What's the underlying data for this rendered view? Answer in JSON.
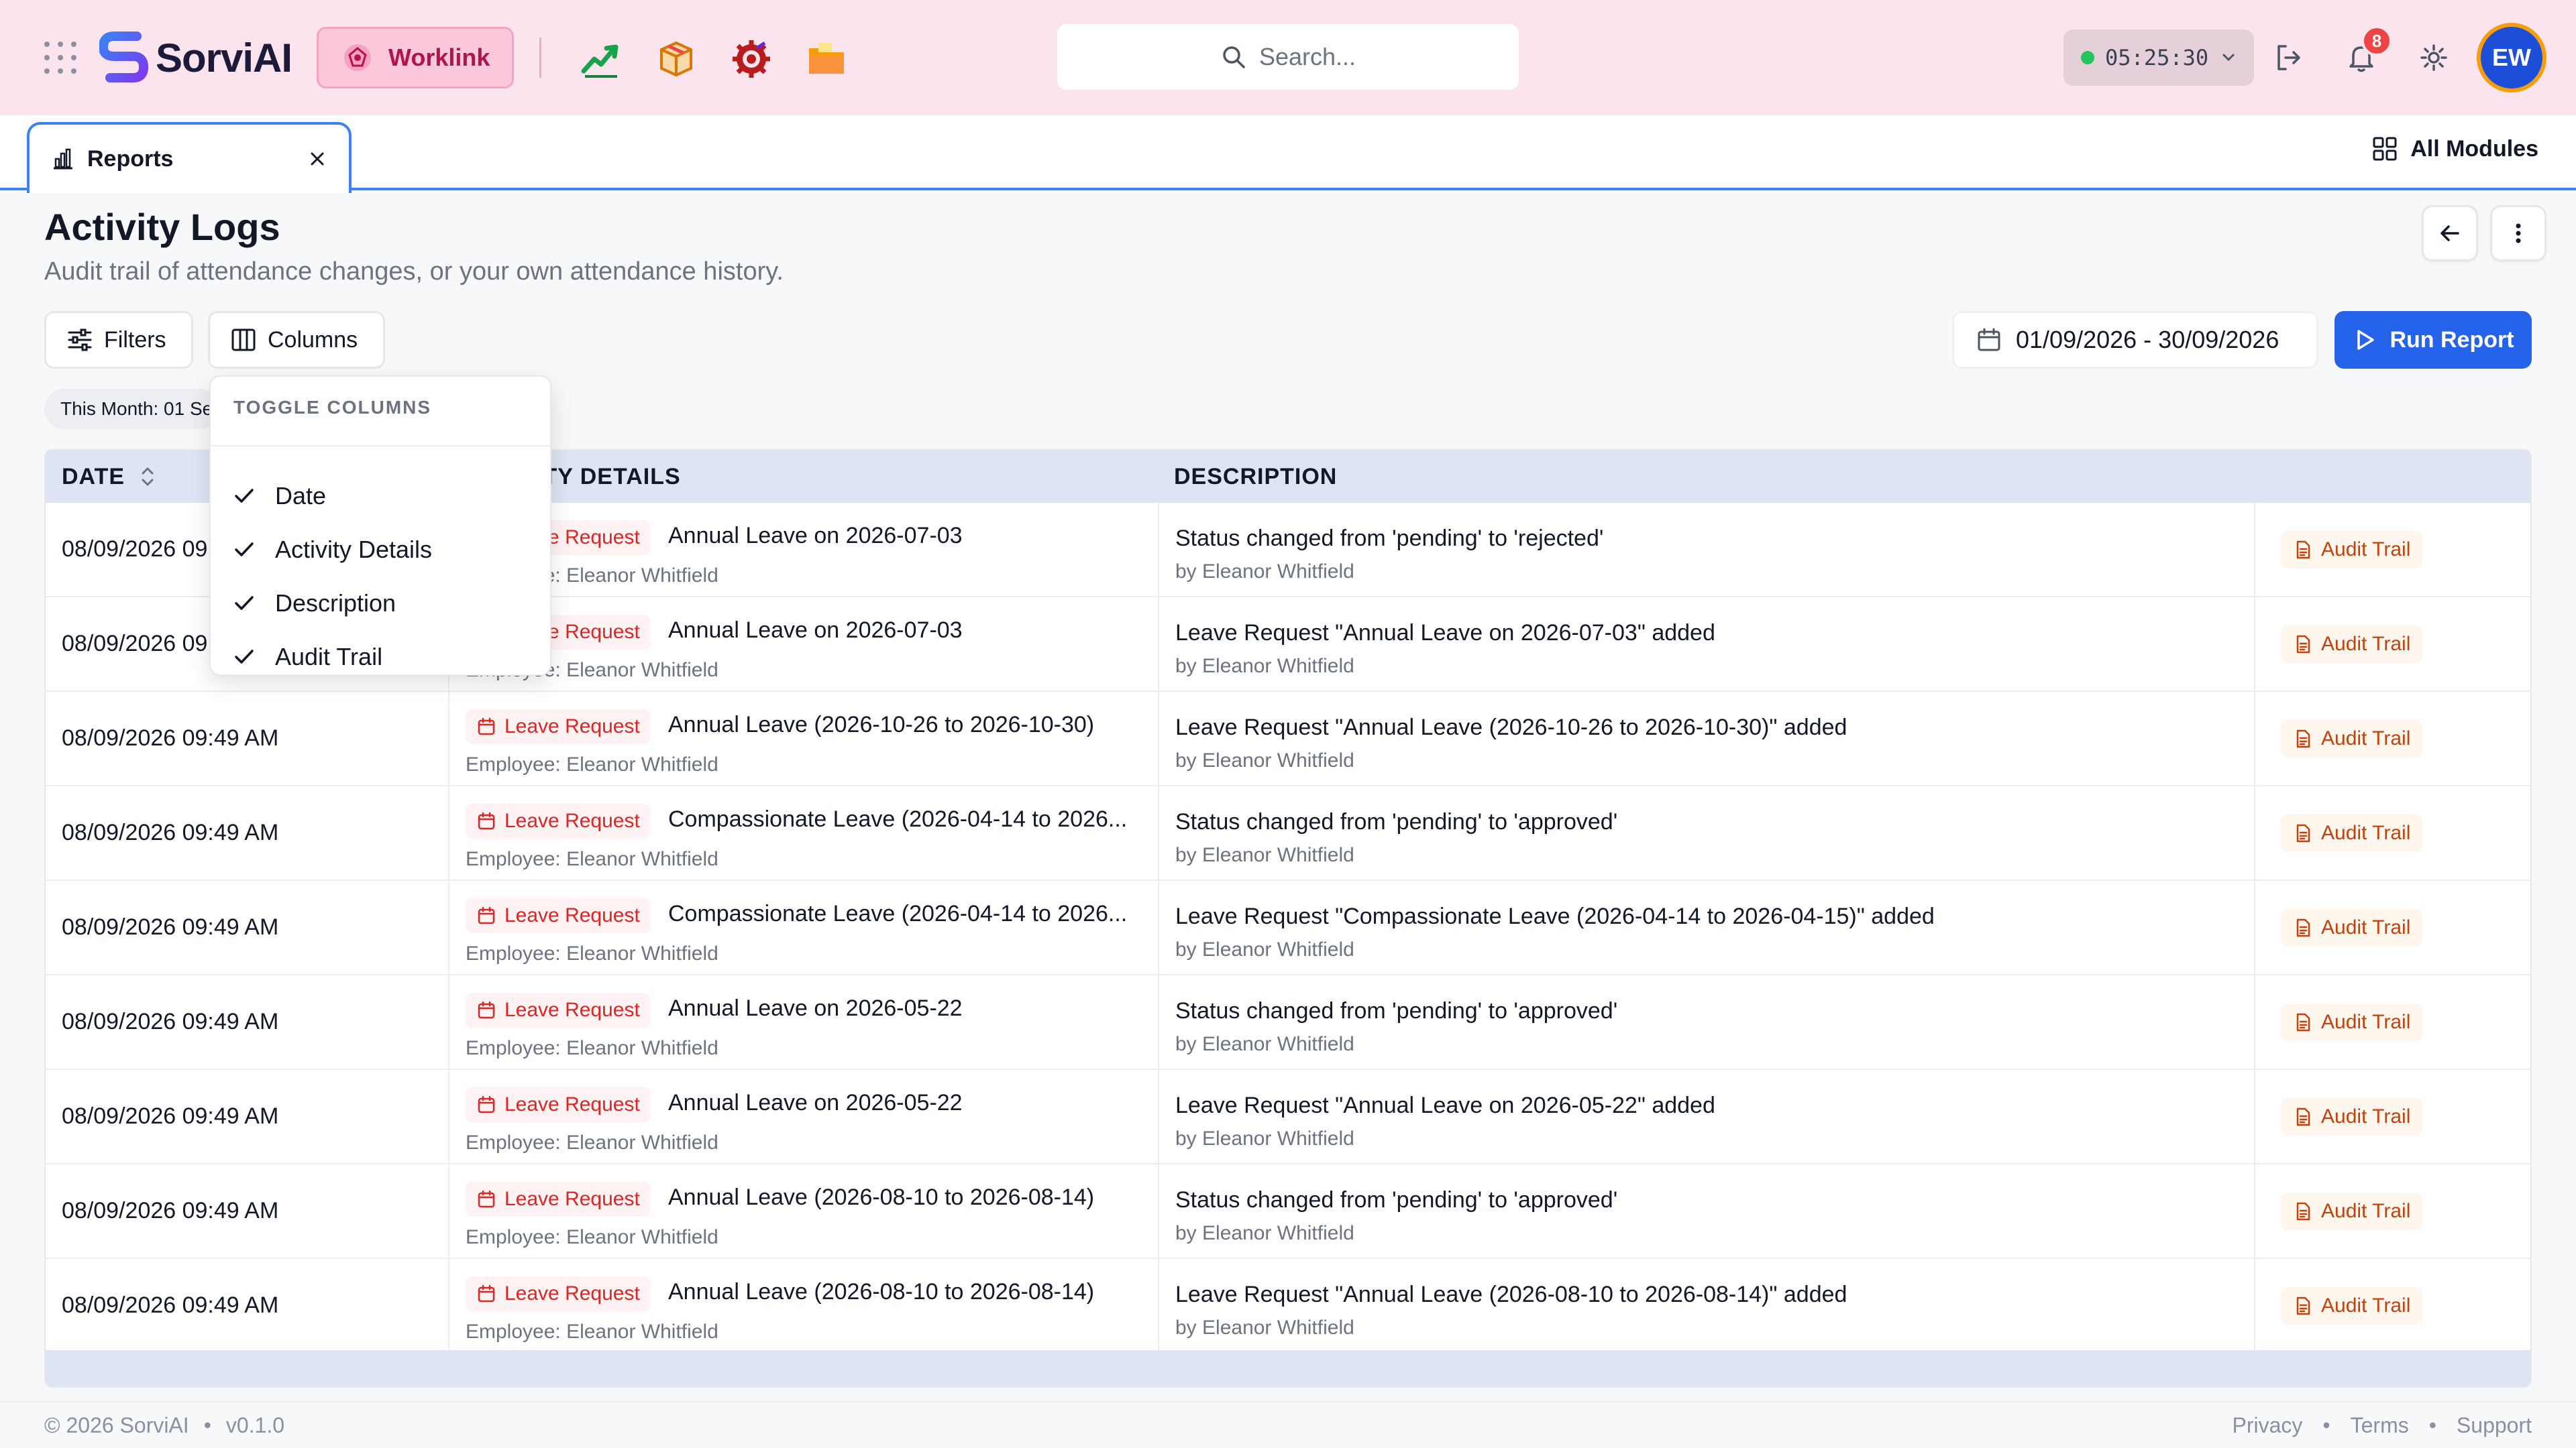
{
  "app": {
    "name": "SorviAI",
    "module": "Worklink"
  },
  "top_bar": {
    "search_placeholder": "Search...",
    "timer": "05:25:30",
    "notification_count": "8",
    "user_initials": "EW",
    "apps": [
      "chart-growth-icon",
      "package-icon",
      "gear-target-icon",
      "folder-icon"
    ]
  },
  "tabs": [
    {
      "label": "Reports"
    }
  ],
  "all_modules_label": "All Modules",
  "page": {
    "title": "Activity Logs",
    "subtitle": "Audit trail of attendance changes, or your own attendance history."
  },
  "toolbar": {
    "filters_label": "Filters",
    "columns_label": "Columns",
    "date_range": "01/09/2026 - 30/09/2026",
    "run_report_label": "Run Report"
  },
  "filter_chip": "This Month: 01 Sep 2026 - 30 Sep 2026",
  "columns_menu": {
    "title": "TOGGLE COLUMNS",
    "items": [
      {
        "label": "Date",
        "checked": true
      },
      {
        "label": "Activity Details",
        "checked": true
      },
      {
        "label": "Description",
        "checked": true
      },
      {
        "label": "Audit Trail",
        "checked": true
      }
    ]
  },
  "table": {
    "headers": {
      "date": "DATE",
      "activity": "ACTIVITY DETAILS",
      "description": "DESCRIPTION"
    },
    "rows": [
      {
        "date": "08/09/2026 09:49 AM",
        "type": "Leave Request",
        "title": "Annual Leave on 2026-07-03",
        "employee": "Employee: Eleanor Whitfield",
        "description": "Status changed from 'pending' to 'rejected'",
        "by": "by Eleanor Whitfield",
        "audit": "Audit Trail"
      },
      {
        "date": "08/09/2026 09:49 AM",
        "type": "Leave Request",
        "title": "Annual Leave on 2026-07-03",
        "employee": "Employee: Eleanor Whitfield",
        "description": "Leave Request \"Annual Leave on 2026-07-03\" added",
        "by": "by Eleanor Whitfield",
        "audit": "Audit Trail"
      },
      {
        "date": "08/09/2026 09:49 AM",
        "type": "Leave Request",
        "title": "Annual Leave (2026-10-26 to 2026-10-30)",
        "employee": "Employee: Eleanor Whitfield",
        "description": "Leave Request \"Annual Leave (2026-10-26 to 2026-10-30)\" added",
        "by": "by Eleanor Whitfield",
        "audit": "Audit Trail"
      },
      {
        "date": "08/09/2026 09:49 AM",
        "type": "Leave Request",
        "title": "Compassionate Leave (2026-04-14 to 2026...",
        "employee": "Employee: Eleanor Whitfield",
        "description": "Status changed from 'pending' to 'approved'",
        "by": "by Eleanor Whitfield",
        "audit": "Audit Trail"
      },
      {
        "date": "08/09/2026 09:49 AM",
        "type": "Leave Request",
        "title": "Compassionate Leave (2026-04-14 to 2026...",
        "employee": "Employee: Eleanor Whitfield",
        "description": "Leave Request \"Compassionate Leave (2026-04-14 to 2026-04-15)\" added",
        "by": "by Eleanor Whitfield",
        "audit": "Audit Trail"
      },
      {
        "date": "08/09/2026 09:49 AM",
        "type": "Leave Request",
        "title": "Annual Leave on 2026-05-22",
        "employee": "Employee: Eleanor Whitfield",
        "description": "Status changed from 'pending' to 'approved'",
        "by": "by Eleanor Whitfield",
        "audit": "Audit Trail"
      },
      {
        "date": "08/09/2026 09:49 AM",
        "type": "Leave Request",
        "title": "Annual Leave on 2026-05-22",
        "employee": "Employee: Eleanor Whitfield",
        "description": "Leave Request \"Annual Leave on 2026-05-22\" added",
        "by": "by Eleanor Whitfield",
        "audit": "Audit Trail"
      },
      {
        "date": "08/09/2026 09:49 AM",
        "type": "Leave Request",
        "title": "Annual Leave (2026-08-10 to 2026-08-14)",
        "employee": "Employee: Eleanor Whitfield",
        "description": "Status changed from 'pending' to 'approved'",
        "by": "by Eleanor Whitfield",
        "audit": "Audit Trail"
      },
      {
        "date": "08/09/2026 09:49 AM",
        "type": "Leave Request",
        "title": "Annual Leave (2026-08-10 to 2026-08-14)",
        "employee": "Employee: Eleanor Whitfield",
        "description": "Leave Request \"Annual Leave (2026-08-10 to 2026-08-14)\" added",
        "by": "by Eleanor Whitfield",
        "audit": "Audit Trail"
      }
    ]
  },
  "footer": {
    "copyright": "© 2026 SorviAI",
    "version": "v0.1.0",
    "links": [
      "Privacy",
      "Terms",
      "Support"
    ]
  },
  "colors": {
    "topbar_bg": "#fce4ef",
    "accent_blue": "#2563eb",
    "worklink_pink": "#b3124f",
    "leave_red": "#dc2626",
    "audit_orange": "#c2410c"
  }
}
